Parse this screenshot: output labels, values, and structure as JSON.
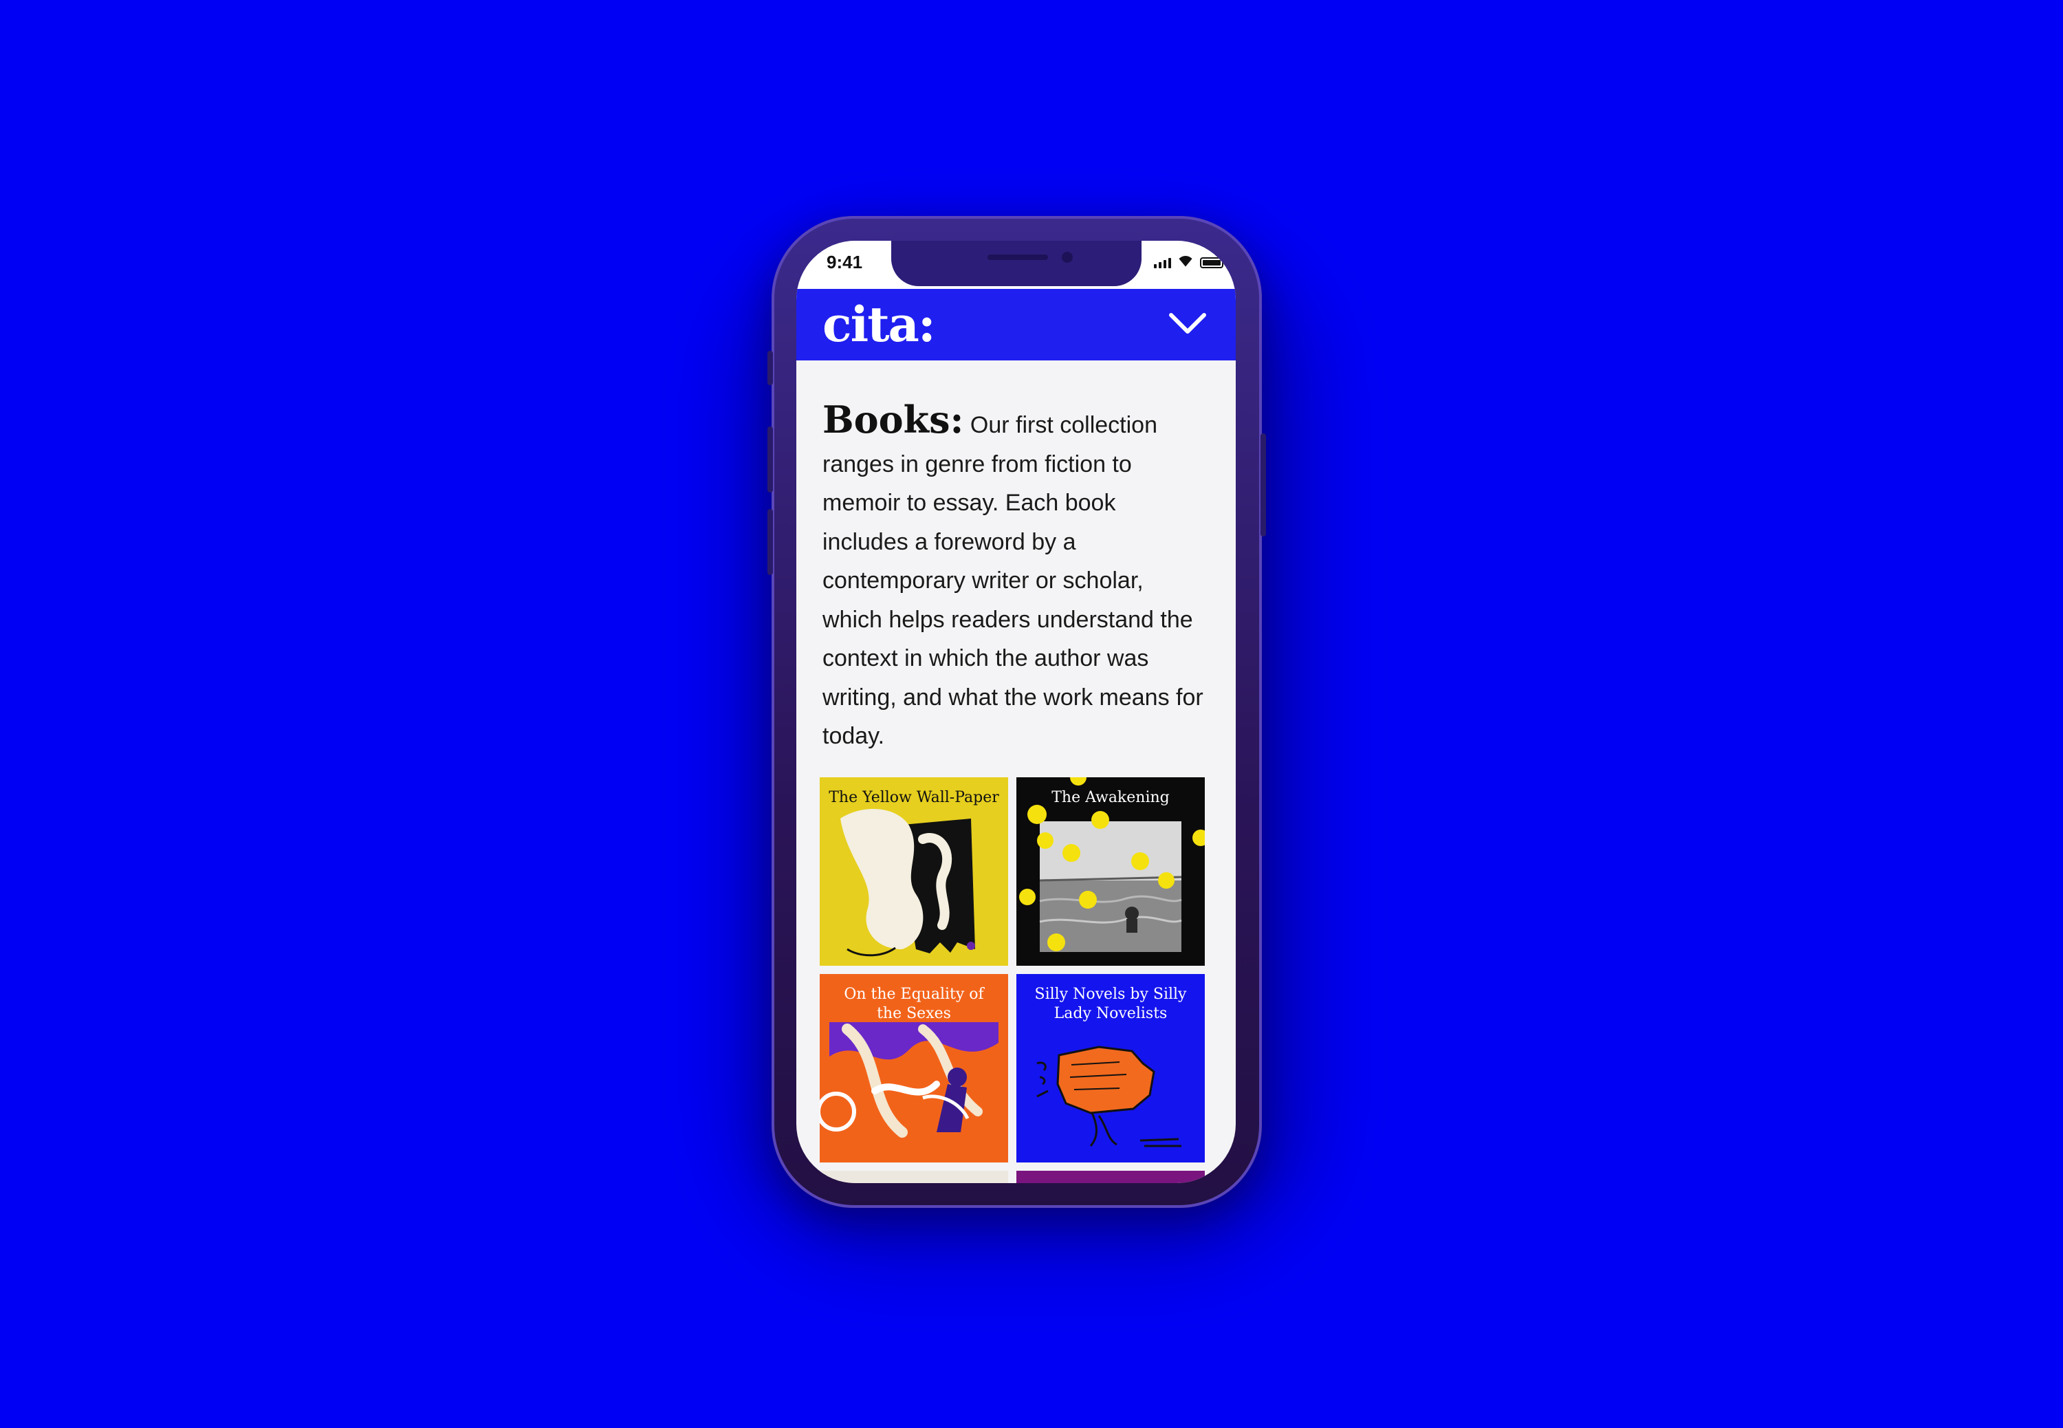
{
  "colors": {
    "background": "#0000f5",
    "nav_bg": "#1f1ff0",
    "screen_bg": "#f4f4f6"
  },
  "status_bar": {
    "time": "9:41"
  },
  "nav": {
    "logo": "cita:",
    "menu_icon": "chevron-down-icon"
  },
  "intro": {
    "heading": "Books:",
    "body": "Our first collection ranges in genre from fiction to memoir to essay. Each book includes a foreword by a contemporary writer or scholar, which helps readers understand the context in which the author was writing, and what the work means for today."
  },
  "books": [
    {
      "title": "The Yellow Wall-Paper",
      "color": "#e6cf1e"
    },
    {
      "title": "The Awakening",
      "color": "#0b0b0b"
    },
    {
      "title": "On the Equality of the Sexes",
      "color": "#f2631a"
    },
    {
      "title": "Silly Novels by Silly Lady Novelists",
      "color": "#1414ee"
    }
  ]
}
